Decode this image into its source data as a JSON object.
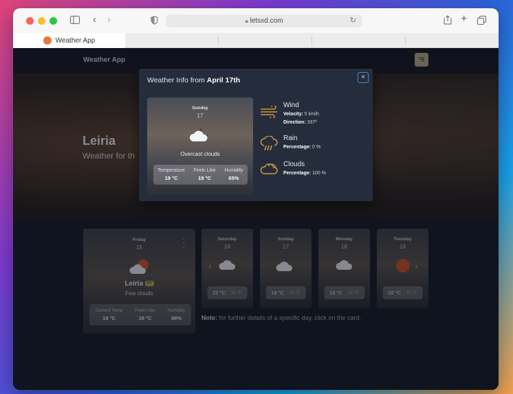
{
  "browser": {
    "address": "letsxd.com",
    "tab_title": "Weather App"
  },
  "navbar": {
    "brand": "Weather App",
    "menu_icon": "menu-icon"
  },
  "hero": {
    "city": "Leiria",
    "subtitle": "Weather for th"
  },
  "today_card": {
    "day": "Friday",
    "date": "15",
    "city": "Leiria",
    "country_badge": "PT",
    "description": "Few clouds",
    "icon": "sun-cloud-icon",
    "stats": [
      {
        "label": "Current Temp",
        "value": "19 °C"
      },
      {
        "label": "Feels Like",
        "value": "18 °C"
      },
      {
        "label": "Humidity",
        "value": "68%"
      }
    ]
  },
  "forecast": [
    {
      "day": "Saturday",
      "date": "16",
      "max": "22 °C",
      "min": "11 °C",
      "icon": "cloud-icon"
    },
    {
      "day": "Sunday",
      "date": "17",
      "max": "19 °C",
      "min": "11 °C",
      "icon": "cloud-moon-icon"
    },
    {
      "day": "Monday",
      "date": "18",
      "max": "19 °C",
      "min": "12 °C",
      "icon": "cloud-icon"
    },
    {
      "day": "Tuesday",
      "date": "19",
      "max": "20 °C",
      "min": "11 °C",
      "icon": "sun-icon"
    }
  ],
  "note": {
    "bold": "Note:",
    "text": "for further details of a specific day, click on the card."
  },
  "modal": {
    "title_prefix": "Weather Info from",
    "title_date": "April 17th",
    "close_label": "×",
    "card": {
      "day": "Sunday",
      "date": "17",
      "description": "Overcast clouds",
      "stats": [
        {
          "label": "Temperature",
          "value": "19 °C"
        },
        {
          "label": "Feels Like",
          "value": "19 °C"
        },
        {
          "label": "Humidity",
          "value": "65%"
        }
      ]
    },
    "wind": {
      "title": "Wind",
      "velocity_label": "Velocity:",
      "velocity_value": "5 km/h",
      "direction_label": "Direction:",
      "direction_value": "337º"
    },
    "rain": {
      "title": "Rain",
      "percentage_label": "Percentage:",
      "percentage_value": "0 %"
    },
    "clouds": {
      "title": "Clouds",
      "percentage_label": "Percentage:",
      "percentage_value": "100 %"
    }
  },
  "colors": {
    "accent": "#d39a3a",
    "modal_bg": "#252d3d",
    "page_bg": "#151a25"
  }
}
